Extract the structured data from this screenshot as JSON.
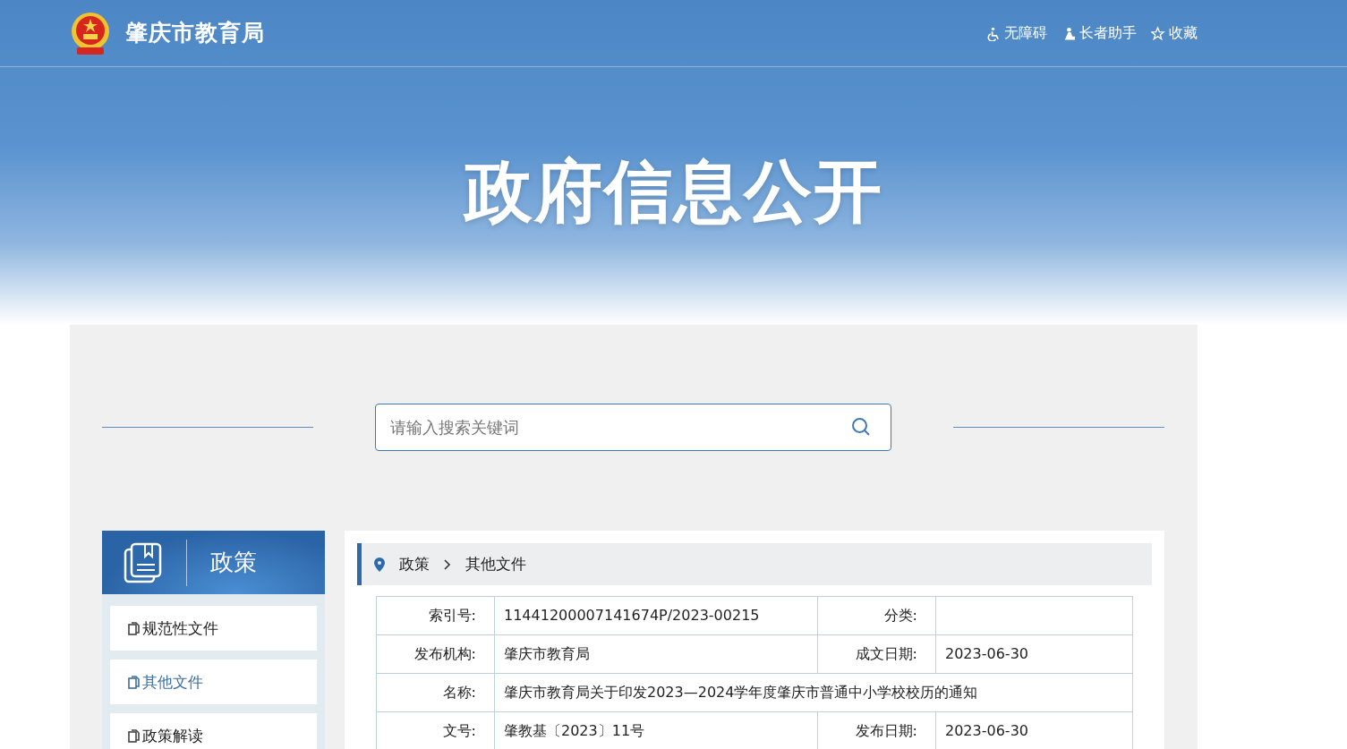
{
  "site_title": "肇庆市教育局",
  "top_links": [
    {
      "label": "无障碍",
      "kind": "accessibility"
    },
    {
      "label": "长者助手",
      "kind": "elder"
    },
    {
      "label": "收藏",
      "kind": "favorite"
    }
  ],
  "hero_title": "政府信息公开",
  "search": {
    "placeholder": "请输入搜索关键词"
  },
  "sidebar": {
    "title": "政策",
    "items": [
      {
        "label": "规范性文件",
        "selected": false
      },
      {
        "label": "其他文件",
        "selected": true
      },
      {
        "label": "政策解读",
        "selected": false
      }
    ]
  },
  "breadcrumb": [
    "政策",
    "其他文件"
  ],
  "info_rows": [
    {
      "fields": [
        {
          "label": "索引号:",
          "value": "11441200007141674P/2023-00215"
        },
        {
          "label": "分类:"
        }
      ]
    },
    {
      "fields": [
        {
          "label": "发布机构:",
          "value": "肇庆市教育局"
        },
        {
          "label": "成文日期:",
          "value": "2023-06-30"
        }
      ]
    },
    {
      "fields": [
        {
          "label": "名称:",
          "value": "肇庆市教育局关于印发2023—2024学年度肇庆市普通中小学校校历的通知"
        }
      ]
    },
    {
      "fields": [
        {
          "label": "文号:",
          "value": "肇教基〔2023〕11号"
        },
        {
          "label": "发布日期:",
          "value": "2023-06-30"
        }
      ]
    }
  ]
}
